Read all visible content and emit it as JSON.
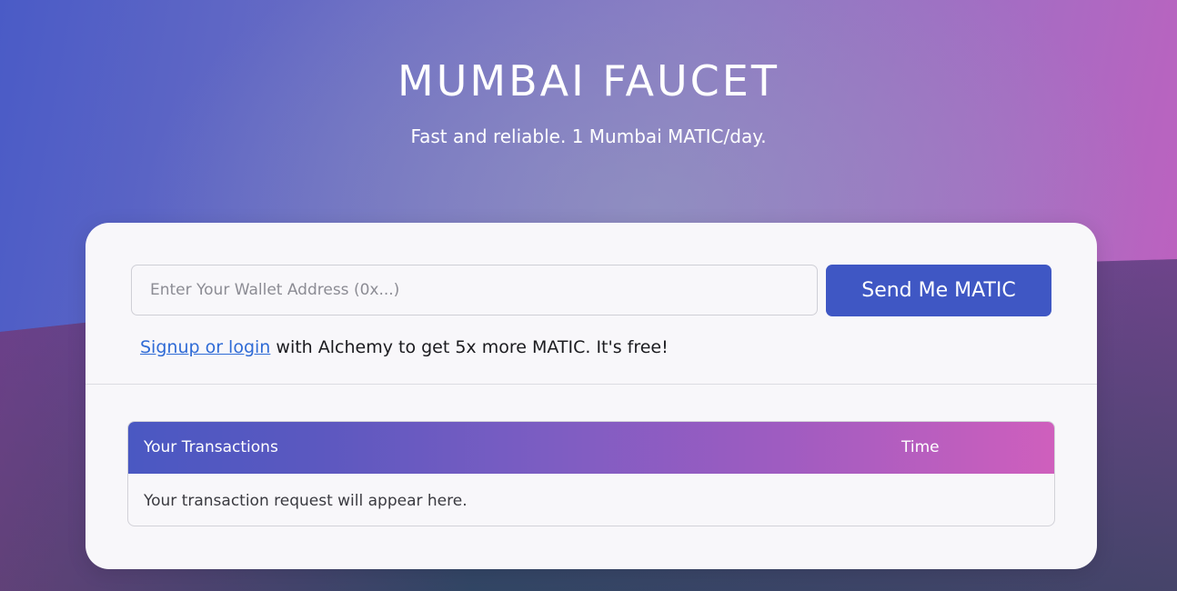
{
  "hero": {
    "title": "MUMBAI FAUCET",
    "subtitle": "Fast and reliable. 1 Mumbai MATIC/day."
  },
  "form": {
    "address_placeholder": "Enter Your Wallet Address (0x...)",
    "address_value": "",
    "send_label": "Send Me MATIC"
  },
  "promo": {
    "link_text": "Signup or login",
    "rest_text": " with Alchemy to get 5x more MATIC. It's free!"
  },
  "transactions": {
    "columns": [
      "Your Transactions",
      "Time"
    ],
    "empty_message": "Your transaction request will appear here."
  },
  "colors": {
    "button": "#3f57c4",
    "link": "#2f6bd6",
    "gradient_start": "#4a58c2",
    "gradient_end": "#cf5fbd"
  }
}
